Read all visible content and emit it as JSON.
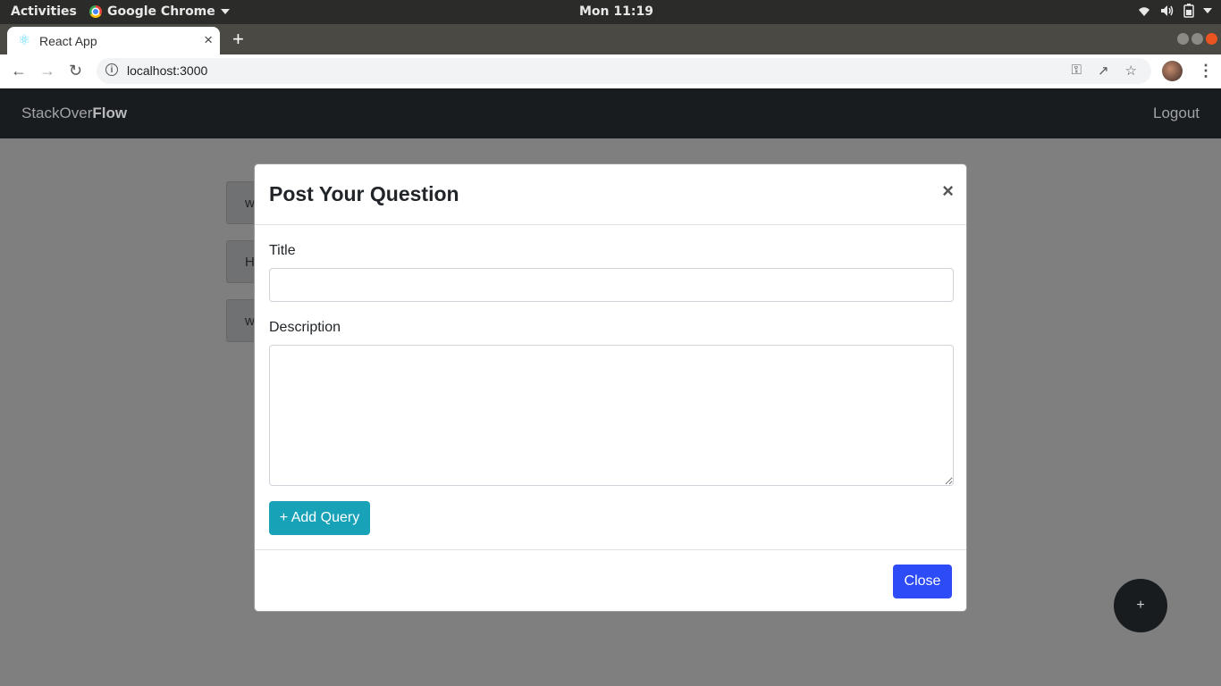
{
  "os_bar": {
    "activities": "Activities",
    "app_name": "Google Chrome",
    "clock": "Mon 11:19"
  },
  "browser": {
    "tab_title": "React App",
    "tab_close": "×",
    "new_tab": "+",
    "url": "localhost:3000"
  },
  "navbar": {
    "brand_prefix": "StackOver",
    "brand_bold": "Flow",
    "logout": "Logout"
  },
  "background_items": [
    {
      "text": "w"
    },
    {
      "text": "H"
    },
    {
      "text": "w"
    }
  ],
  "modal": {
    "title": "Post Your Question",
    "close_x": "×",
    "title_label": "Title",
    "title_value": "",
    "description_label": "Description",
    "description_value": "",
    "add_button": "+ Add Query",
    "close_button": "Close"
  },
  "fab": {
    "label": "+"
  },
  "colors": {
    "accent_add": "#17a2b8",
    "accent_close": "#2d4cf7",
    "navbar_bg": "#191c1f"
  }
}
